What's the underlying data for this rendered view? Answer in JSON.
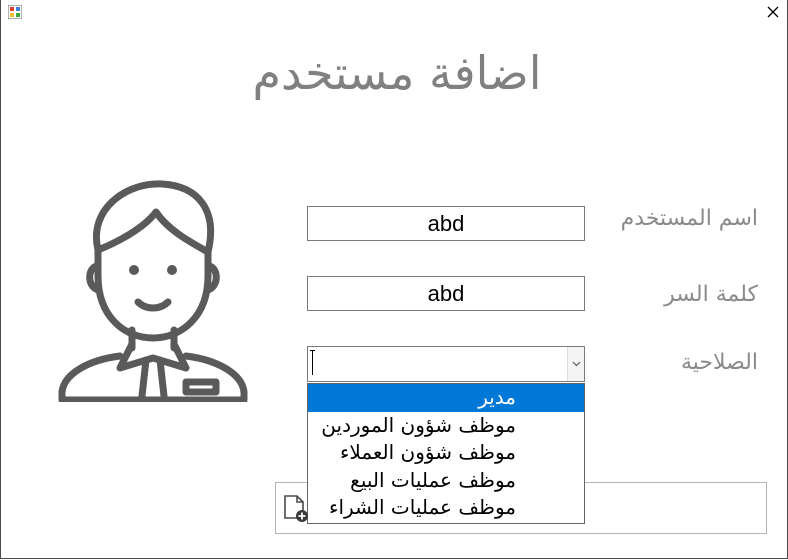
{
  "window": {
    "close_glyph": "✕"
  },
  "title": "اضافة مستخدم",
  "form": {
    "username": {
      "label": "اسم المستخدم",
      "value": "abd"
    },
    "password": {
      "label": "كلمة السر",
      "value": "abd"
    },
    "role": {
      "label": "الصلاحية",
      "value": "",
      "options": [
        "مدير",
        "موظف شؤون الموردين",
        "موظف شؤون العملاء",
        "موظف عمليات البيع",
        "موظف عمليات الشراء"
      ],
      "selected_index": 0
    }
  },
  "icons": {
    "app": "app-icon",
    "close": "close-icon",
    "avatar": "user-avatar-icon",
    "dropdown": "chevron-down-icon",
    "add_document": "add-document-icon"
  },
  "colors": {
    "title": "#808080",
    "label": "#8a8a8a",
    "selection": "#0078d7",
    "avatar": "#5a5a5a"
  }
}
